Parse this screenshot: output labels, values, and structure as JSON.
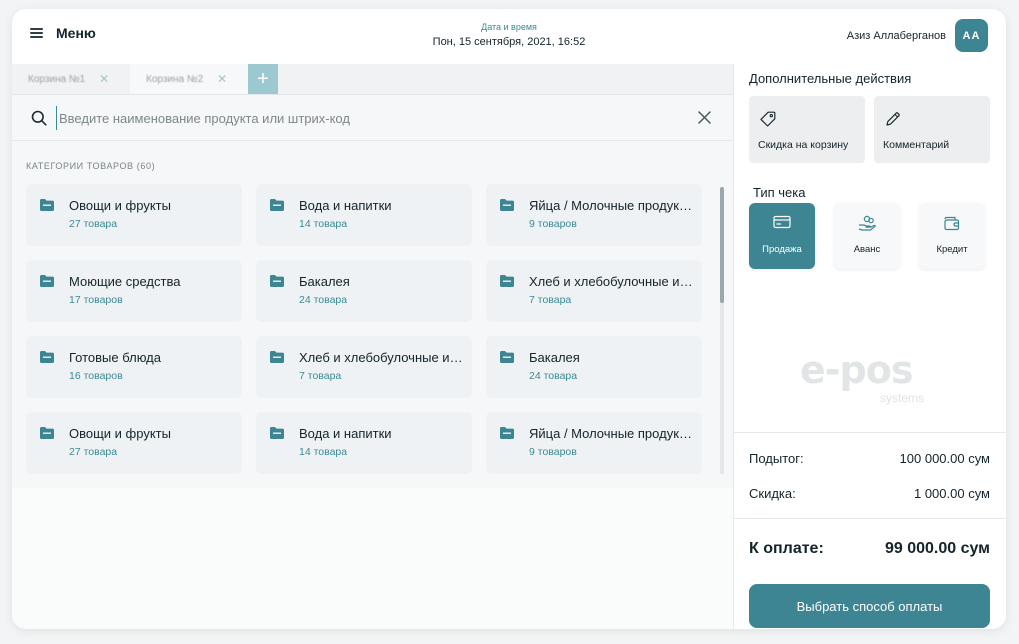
{
  "header": {
    "menu_label": "Меню",
    "datetime_label": "Дата и время",
    "datetime_value": "Пон, 15 сентября, 2021, 16:52",
    "user_name": "Азиз Аллаберганов",
    "user_initials": "AA"
  },
  "tabs": [
    {
      "label": "Корзина №1"
    },
    {
      "label": "Корзина №2"
    }
  ],
  "tab_add_icon": "plus-icon",
  "search": {
    "placeholder": "Введите наименование продукта или штрих-код",
    "value": ""
  },
  "categories": {
    "title": "КАТЕГОРИИ ТОВАРОВ (60)",
    "items": [
      {
        "name": "Овощи и фрукты",
        "count": "27 товара"
      },
      {
        "name": "Вода и напитки",
        "count": "14 товара"
      },
      {
        "name": "Яйца / Молочные продукты",
        "count": "9 товаров"
      },
      {
        "name": "Моющие средства",
        "count": "17 товаров"
      },
      {
        "name": "Бакалея",
        "count": "24 товара"
      },
      {
        "name": "Хлеб и хлебобулочные изделия",
        "count": "7 товара"
      },
      {
        "name": "Готовые блюда",
        "count": "16 товаров"
      },
      {
        "name": "Хлеб и хлебобулочные изделия",
        "count": "7 товара"
      },
      {
        "name": "Бакалея",
        "count": "24 товара"
      },
      {
        "name": "Овощи и фрукты",
        "count": "27 товара"
      },
      {
        "name": "Вода и напитки",
        "count": "14 товара"
      },
      {
        "name": "Яйца / Молочные продукты",
        "count": "9 товаров"
      }
    ]
  },
  "side": {
    "actions_title": "Дополнительные действия",
    "actions": [
      {
        "label": "Скидка на корзину",
        "icon": "tag-icon"
      },
      {
        "label": "Комментарий",
        "icon": "pencil-icon"
      }
    ],
    "receipt_title": "Тип чека",
    "receipt_types": [
      {
        "label": "Продажа",
        "icon": "card-icon",
        "active": true
      },
      {
        "label": "Аванс",
        "icon": "hand-coins-icon",
        "active": false
      },
      {
        "label": "Кредит",
        "icon": "wallet-icon",
        "active": false
      }
    ],
    "logo_text": "e-pos",
    "logo_sub": "systems",
    "subtotal_label": "Подытог:",
    "subtotal_value": "100 000.00 сум",
    "discount_label": "Скидка:",
    "discount_value": "1 000.00 сум",
    "total_label": "К оплате:",
    "total_value": "99 000.00 сум",
    "pay_button": "Выбрать способ оплаты"
  },
  "colors": {
    "accent": "#3d8592",
    "accent_text": "#3a8a96",
    "card_bg": "#eef2f4"
  }
}
